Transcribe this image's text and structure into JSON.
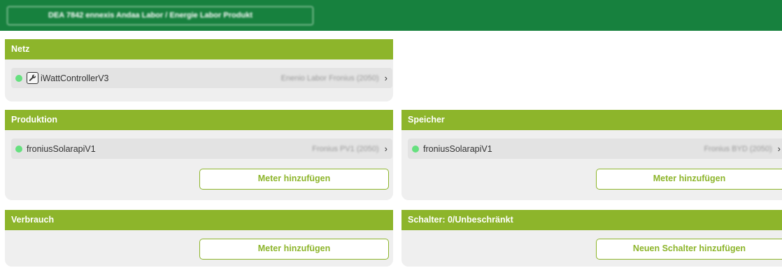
{
  "topbar": {
    "title": "DEA 7842 ennexis Andaa Labor / Energie Labor Produkt"
  },
  "colors": {
    "header_green": "#17813e",
    "section_green": "#8db52b",
    "status_online": "#66e07f"
  },
  "sections": {
    "netz": {
      "title": "Netz",
      "devices": [
        {
          "name": "iWattControllerV3",
          "location": "Enenio Labor Fronius (2050)",
          "status": "online",
          "icon": "wrench-icon"
        }
      ]
    },
    "produktion": {
      "title": "Produktion",
      "devices": [
        {
          "name": "froniusSolarapiV1",
          "location": "Fronius PV1 (2050)",
          "status": "online"
        }
      ],
      "button": "Meter hinzufügen"
    },
    "speicher": {
      "title": "Speicher",
      "devices": [
        {
          "name": "froniusSolarapiV1",
          "location": "Fronius BYD (2050)",
          "status": "online"
        }
      ],
      "button": "Meter hinzufügen"
    },
    "verbrauch": {
      "title": "Verbrauch",
      "button": "Meter hinzufügen"
    },
    "schalter": {
      "title": "Schalter: 0/Unbeschränkt",
      "button": "Neuen Schalter hinzufügen"
    }
  }
}
